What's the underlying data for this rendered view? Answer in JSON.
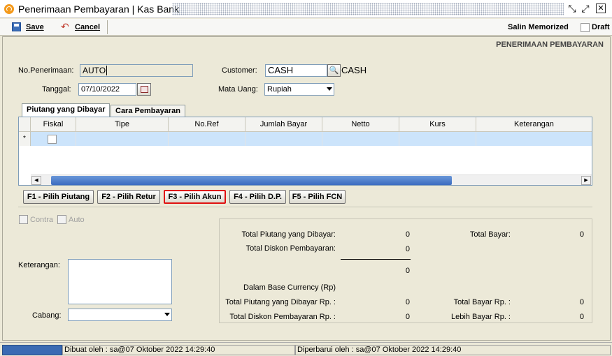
{
  "window": {
    "title": "Penerimaan Pembayaran | Kas Bank"
  },
  "toolbar": {
    "save_label": "Save",
    "cancel_label": "Cancel",
    "salin_memorized_label": "Salin Memorized",
    "draft_label": "Draft"
  },
  "form": {
    "heading": "PENERIMAAN PEMBAYARAN",
    "no_penerimaan_label": "No.Penerimaan:",
    "no_penerimaan_value": "AUTO",
    "tanggal_label": "Tanggal:",
    "tanggal_value": "07/10/2022",
    "customer_label": "Customer:",
    "customer_value": "CASH",
    "customer_name": "CASH",
    "mata_uang_label": "Mata Uang:",
    "mata_uang_value": "Rupiah"
  },
  "tabs": [
    {
      "label": "Piutang yang Dibayar",
      "active": true
    },
    {
      "label": "Cara Pembayaran",
      "active": false
    }
  ],
  "grid": {
    "columns": [
      "Fiskal",
      "Tipe",
      "No.Ref",
      "Jumlah Bayar",
      "Netto",
      "Kurs",
      "Keterangan"
    ],
    "new_row_marker": "*"
  },
  "function_buttons": [
    {
      "label": "F1 - Pilih Piutang"
    },
    {
      "label": "F2 - Pilih Retur"
    },
    {
      "label": "F3 - Pilih Akun",
      "highlighted": true
    },
    {
      "label": "F4 - Pilih D.P."
    },
    {
      "label": "F5 - Pilih FCN"
    }
  ],
  "options": {
    "contra_label": "Contra",
    "auto_label": "Auto"
  },
  "bottom": {
    "keterangan_label": "Keterangan:",
    "cabang_label": "Cabang:"
  },
  "totals": {
    "total_piutang_label": "Total Piutang yang Dibayar:",
    "total_piutang_value": "0",
    "total_diskon_label": "Total Diskon Pembayaran:",
    "total_diskon_value": "0",
    "subtotal_value": "0",
    "total_bayar_label": "Total Bayar:",
    "total_bayar_value": "0",
    "base_currency_label": "Dalam Base Currency (Rp)",
    "total_piutang_rp_label": "Total Piutang yang Dibayar Rp. :",
    "total_piutang_rp_value": "0",
    "total_diskon_rp_label": "Total Diskon Pembayaran Rp. :",
    "total_diskon_rp_value": "0",
    "total_bayar_rp_label": "Total Bayar Rp. :",
    "total_bayar_rp_value": "0",
    "lebih_bayar_rp_label": "Lebih Bayar Rp. :",
    "lebih_bayar_rp_value": "0"
  },
  "status": {
    "dibuat": "Dibuat oleh : sa@07 Oktober 2022  14:29:40",
    "diperbarui": "Diperbarui oleh : sa@07 Oktober 2022  14:29:40"
  },
  "colors": {
    "selected_row": "#cce4fb",
    "highlight_border": "#e01010",
    "scroll_thumb": "#3c6cc0"
  }
}
